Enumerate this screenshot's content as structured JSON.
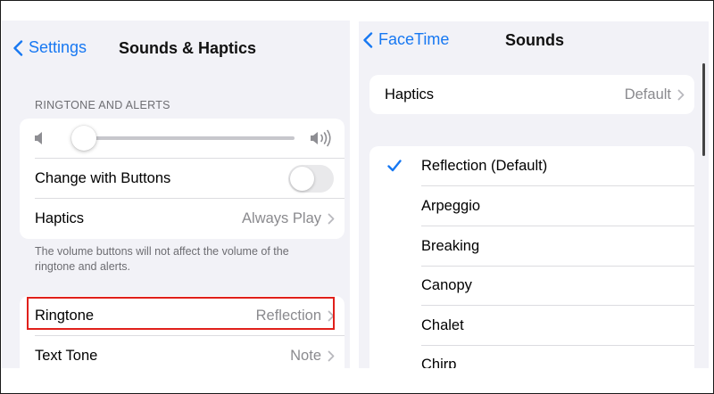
{
  "left": {
    "nav": {
      "back_label": "Settings",
      "title": "Sounds & Haptics"
    },
    "section_header": "RINGTONE AND ALERTS",
    "volume": {
      "level": 0.05
    },
    "rows": {
      "change_with_buttons": {
        "label": "Change with Buttons",
        "toggle_on": false
      },
      "haptics": {
        "label": "Haptics",
        "value": "Always Play"
      }
    },
    "footer_note_line1": "The volume buttons will not affect the volume of the",
    "footer_note_line2": "ringtone and alerts.",
    "sound_rows": {
      "ringtone": {
        "label": "Ringtone",
        "value": "Reflection"
      },
      "text_tone": {
        "label": "Text Tone",
        "value": "Note"
      }
    }
  },
  "right": {
    "nav": {
      "back_label": "FaceTime",
      "title": "Sounds"
    },
    "haptics": {
      "label": "Haptics",
      "value": "Default"
    },
    "tones": [
      "Reflection (Default)",
      "Arpeggio",
      "Breaking",
      "Canopy",
      "Chalet",
      "Chirp"
    ],
    "selected_tone": "Reflection (Default)"
  },
  "colors": {
    "accent": "#1778f2",
    "highlight": "#e0201b",
    "background": "#f2f2f7"
  },
  "icons": [
    "chevron-left-icon",
    "speaker-low-icon",
    "speaker-high-icon",
    "chevron-right-icon",
    "checkmark-icon"
  ]
}
